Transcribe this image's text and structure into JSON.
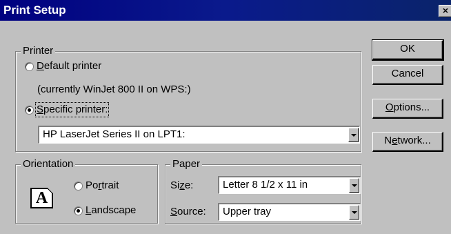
{
  "window": {
    "title": "Print Setup",
    "close_glyph": "×"
  },
  "printer_group": {
    "legend": "Printer",
    "default_option": {
      "label_prefix": "",
      "accel": "D",
      "label_rest": "efault printer",
      "selected": false
    },
    "current_note": "(currently WinJet 800 II on WPS:)",
    "specific_option": {
      "accel": "S",
      "label_rest": "pecific printer:",
      "selected": true
    },
    "printer_select": {
      "value": "HP LaserJet Series II on LPT1:"
    }
  },
  "orientation_group": {
    "legend": "Orientation",
    "icon_letter": "A",
    "portrait": {
      "pre": "Po",
      "accel": "r",
      "rest": "trait",
      "selected": false
    },
    "landscape": {
      "accel": "L",
      "rest": "andscape",
      "selected": true
    }
  },
  "paper_group": {
    "legend": "Paper",
    "size": {
      "pre": "Si",
      "accel": "z",
      "rest": "e:",
      "value": "Letter 8 1/2 x 11 in"
    },
    "source": {
      "accel": "S",
      "rest": "ource:",
      "value": "Upper tray"
    }
  },
  "buttons": {
    "ok": "OK",
    "cancel": "Cancel",
    "options": {
      "accel": "O",
      "rest": "ptions..."
    },
    "network": {
      "pre": "N",
      "accel": "e",
      "rest": "twork..."
    }
  },
  "colors": {
    "titlebar": "#000080",
    "face": "#c0c0c0"
  }
}
